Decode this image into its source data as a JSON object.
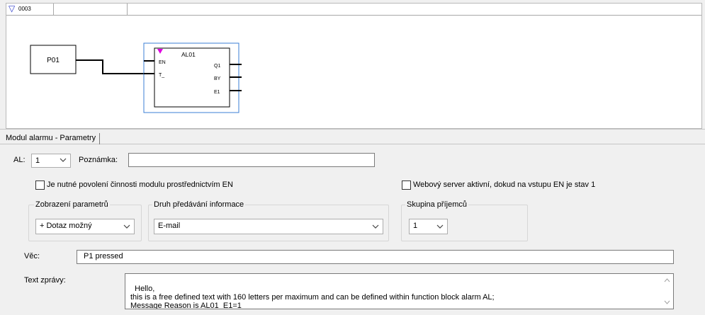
{
  "rung": {
    "toggle_icon": "triangle-down",
    "number": "0003"
  },
  "diagram": {
    "input_block": {
      "label": "P01"
    },
    "alarm_block": {
      "name": "AL01",
      "inputs": [
        "EN",
        "T_"
      ],
      "outputs": [
        "Q1",
        "BY",
        "E1"
      ]
    },
    "colors": {
      "selection": "#3b7fd6",
      "marker": "#e000e0",
      "wire": "#000000"
    }
  },
  "panel": {
    "tab_label": "Modul alarmu - Parametry",
    "al_label": "AL:",
    "al_value": "1",
    "note_label": "Poznámka:",
    "note_value": "",
    "enable_checkbox_label": "Je nutné povolení činnosti modulu prostřednictvím EN",
    "enable_checked": false,
    "web_checkbox_label": "Webový server aktivní, dokud na vstupu EN je stav 1",
    "web_checked": false,
    "display_group": {
      "title": "Zobrazení parametrů",
      "value": "+ Dotaz možný"
    },
    "delivery_group": {
      "title": "Druh předávání informace",
      "value": "E-mail"
    },
    "recipients_group": {
      "title": "Skupina příjemců",
      "value": "1"
    },
    "subject_label": "Věc:",
    "subject_value": "P1 pressed",
    "message_label": "Text zprávy:",
    "message_value": "Hello,\nthis is a free defined text with 160 letters per maximum and can be defined within function block alarm AL;\nMessage Reason is AL01_E1=1"
  }
}
